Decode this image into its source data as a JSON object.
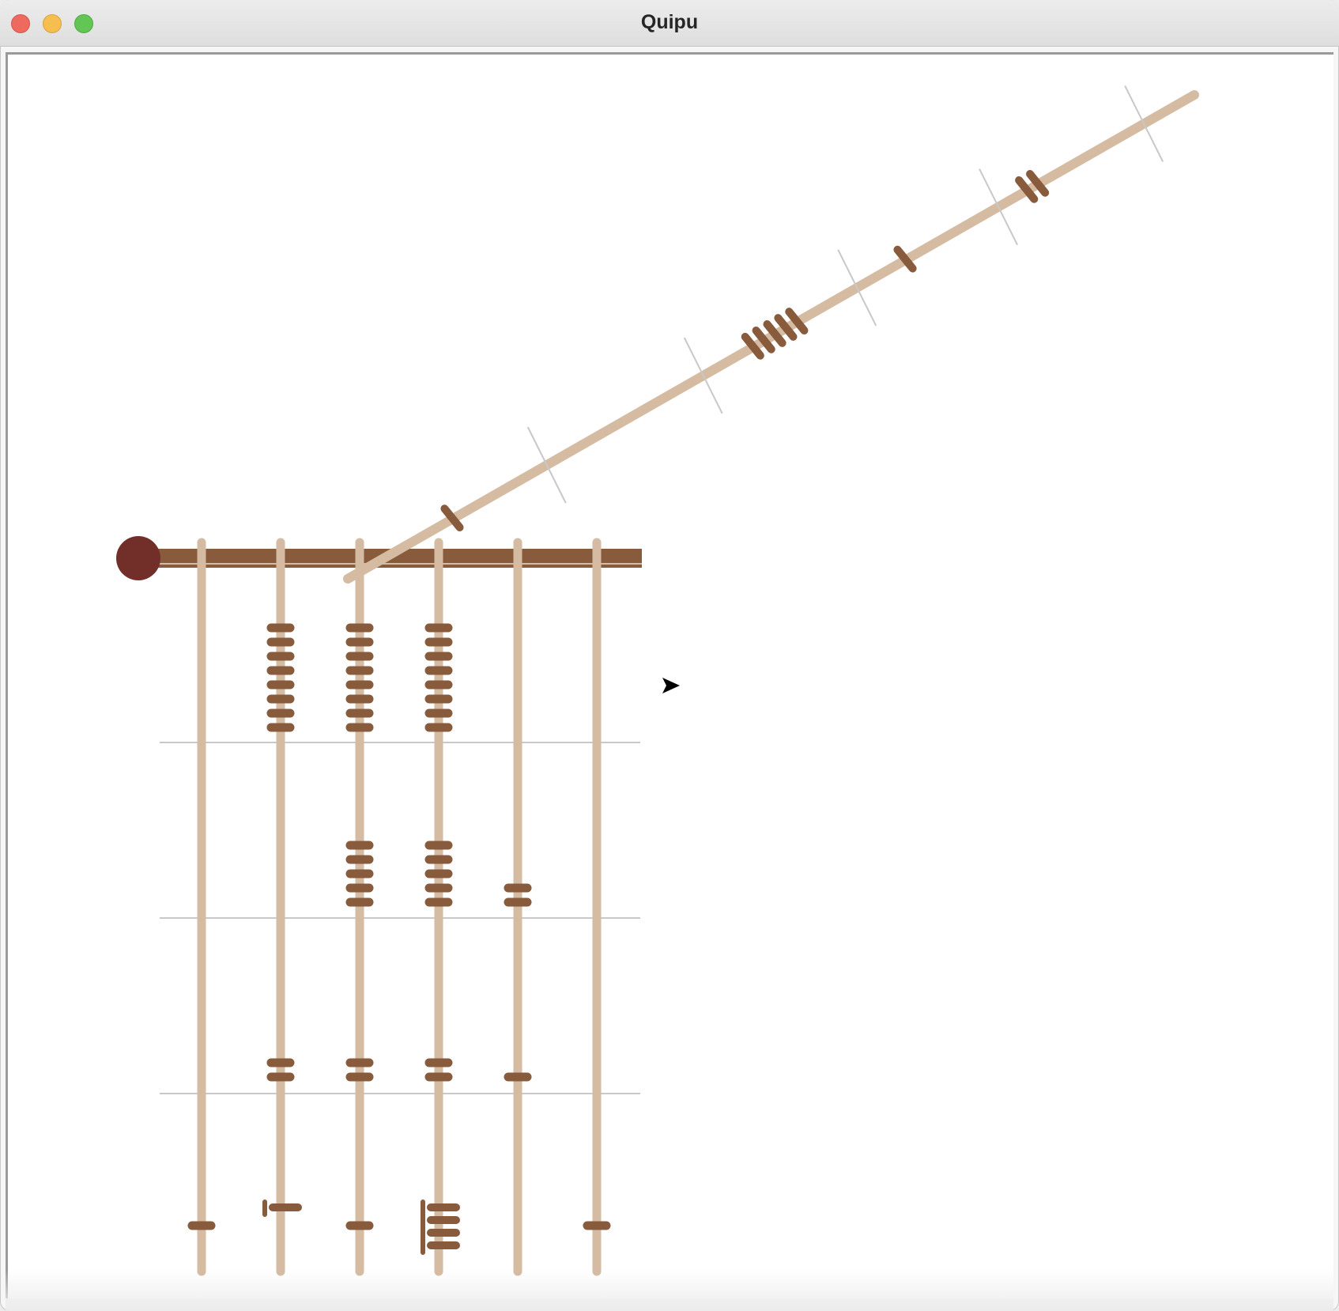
{
  "window": {
    "title": "Quipu"
  },
  "colors": {
    "cord": "#d4bba1",
    "knot": "#885b3c",
    "primary_cord": "#885b3c",
    "top_knot": "#722e29",
    "guide": "#c8c8c8"
  },
  "quipu": {
    "pendant_cords": [
      {
        "name": "cord-1",
        "value": 1,
        "digits": [
          0,
          0,
          0,
          1
        ]
      },
      {
        "name": "cord-2",
        "value": 8022,
        "digits": [
          8,
          0,
          2,
          2
        ]
      },
      {
        "name": "cord-3",
        "value": 8521,
        "digits": [
          8,
          5,
          2,
          1
        ]
      },
      {
        "name": "cord-4",
        "value": 8525,
        "digits": [
          8,
          5,
          2,
          5
        ]
      },
      {
        "name": "cord-5",
        "value": 21,
        "digits": [
          0,
          2,
          1,
          0
        ]
      },
      {
        "name": "cord-6",
        "value": 1,
        "digits": [
          0,
          0,
          0,
          1
        ]
      }
    ],
    "top_cord": {
      "name": "top-cord",
      "value": 1512,
      "digits": [
        1,
        0,
        5,
        1,
        2
      ]
    }
  },
  "cursor": {
    "icon": "arrow-cursor-icon"
  }
}
